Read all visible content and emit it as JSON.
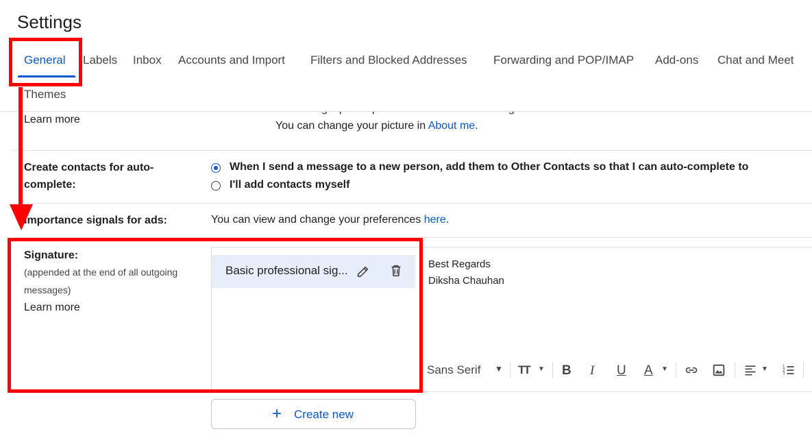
{
  "page": {
    "title": "Settings"
  },
  "tabs": [
    {
      "label": "General",
      "active": true
    },
    {
      "label": "Labels"
    },
    {
      "label": "Inbox"
    },
    {
      "label": "Accounts and Import"
    },
    {
      "label": "Filters and Blocked Addresses"
    },
    {
      "label": "Forwarding and POP/IMAP"
    },
    {
      "label": "Add-ons"
    },
    {
      "label": "Chat and Meet"
    },
    {
      "label": "Themes"
    }
  ],
  "picture_section": {
    "clipped_text": "Your Google profile picture is visible across Google services.",
    "learn_more": "Learn more",
    "change_text": "You can change your picture in",
    "about_me_link": "About me",
    "period": "."
  },
  "auto_complete": {
    "label": "Create contacts for auto-complete:",
    "options": [
      {
        "label": "When I send a message to a new person, add them to Other Contacts so that I can auto-complete to",
        "selected": true
      },
      {
        "label": "I'll add contacts myself",
        "selected": false
      }
    ]
  },
  "importance": {
    "label": "Importance signals for ads:",
    "text": "You can view and change your preferences",
    "link": "here",
    "period": "."
  },
  "signature": {
    "label": "Signature:",
    "note": "(appended at the end of all outgoing messages)",
    "learn_more": "Learn more",
    "items": [
      {
        "name": "Basic professional sig..."
      }
    ],
    "body_lines": [
      "Best Regards",
      "Diksha Chauhan"
    ],
    "create_new": "Create new",
    "toolbar": {
      "font": "Sans Serif"
    }
  },
  "annotation_color": "#ff0000",
  "accent_color": "#0b57d0"
}
